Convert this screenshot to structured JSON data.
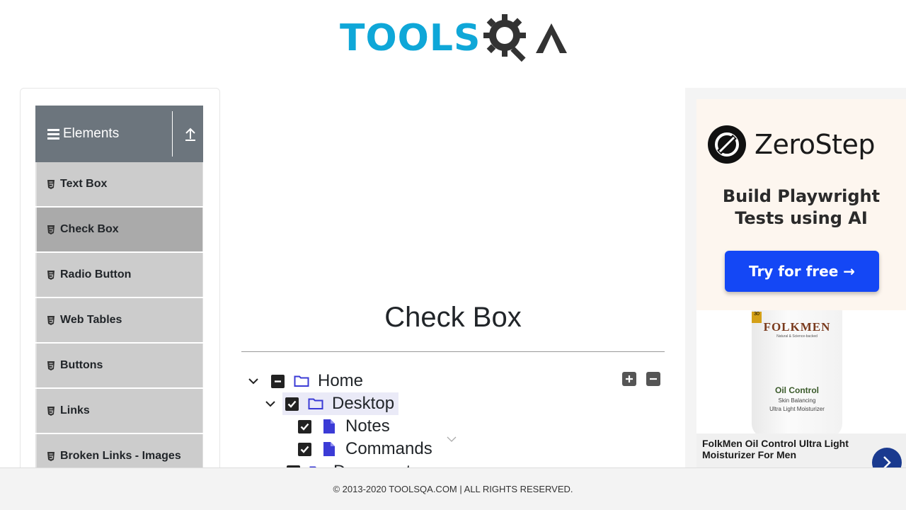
{
  "header": {
    "logo_tools": "TOOLS",
    "logo_qa": "QA"
  },
  "sidebar": {
    "group_title": "Elements",
    "items": [
      {
        "label": "Text Box",
        "active": false
      },
      {
        "label": "Check Box",
        "active": true
      },
      {
        "label": "Radio Button",
        "active": false
      },
      {
        "label": "Web Tables",
        "active": false
      },
      {
        "label": "Buttons",
        "active": false
      },
      {
        "label": "Links",
        "active": false
      },
      {
        "label": "Broken Links - Images",
        "active": false
      }
    ]
  },
  "main": {
    "title": "Check Box",
    "tree": {
      "home": "Home",
      "desktop": "Desktop",
      "notes": "Notes",
      "commands": "Commands",
      "documents": "Documents"
    }
  },
  "ads": {
    "top_brand": "ZeroStep",
    "top_tagline_1": "Build Playwright",
    "top_tagline_2": "Tests using AI",
    "top_button": "Try for free →",
    "bottom_brand": "FOLKMEN",
    "bottom_brand_sub": "Natural & Science-backed",
    "bottom_spf": "30",
    "bottom_product": "Oil Control",
    "bottom_product_sub_1": "Skin Balancing",
    "bottom_product_sub_2": "Ultra Light Moisturizer",
    "bottom_caption": "FolkMen Oil Control Ultra Light Moisturizer For Men"
  },
  "footer": {
    "text": "© 2013-2020 TOOLSQA.COM | ALL RIGHTS RESERVED."
  },
  "colors": {
    "logo_blue": "#0fa7d8",
    "group_header": "#6c757d",
    "menu_item": "#cccccc",
    "menu_active": "#aaaaaa",
    "folder_icon": "#3b3bd6",
    "ad_button": "#1447f5"
  }
}
